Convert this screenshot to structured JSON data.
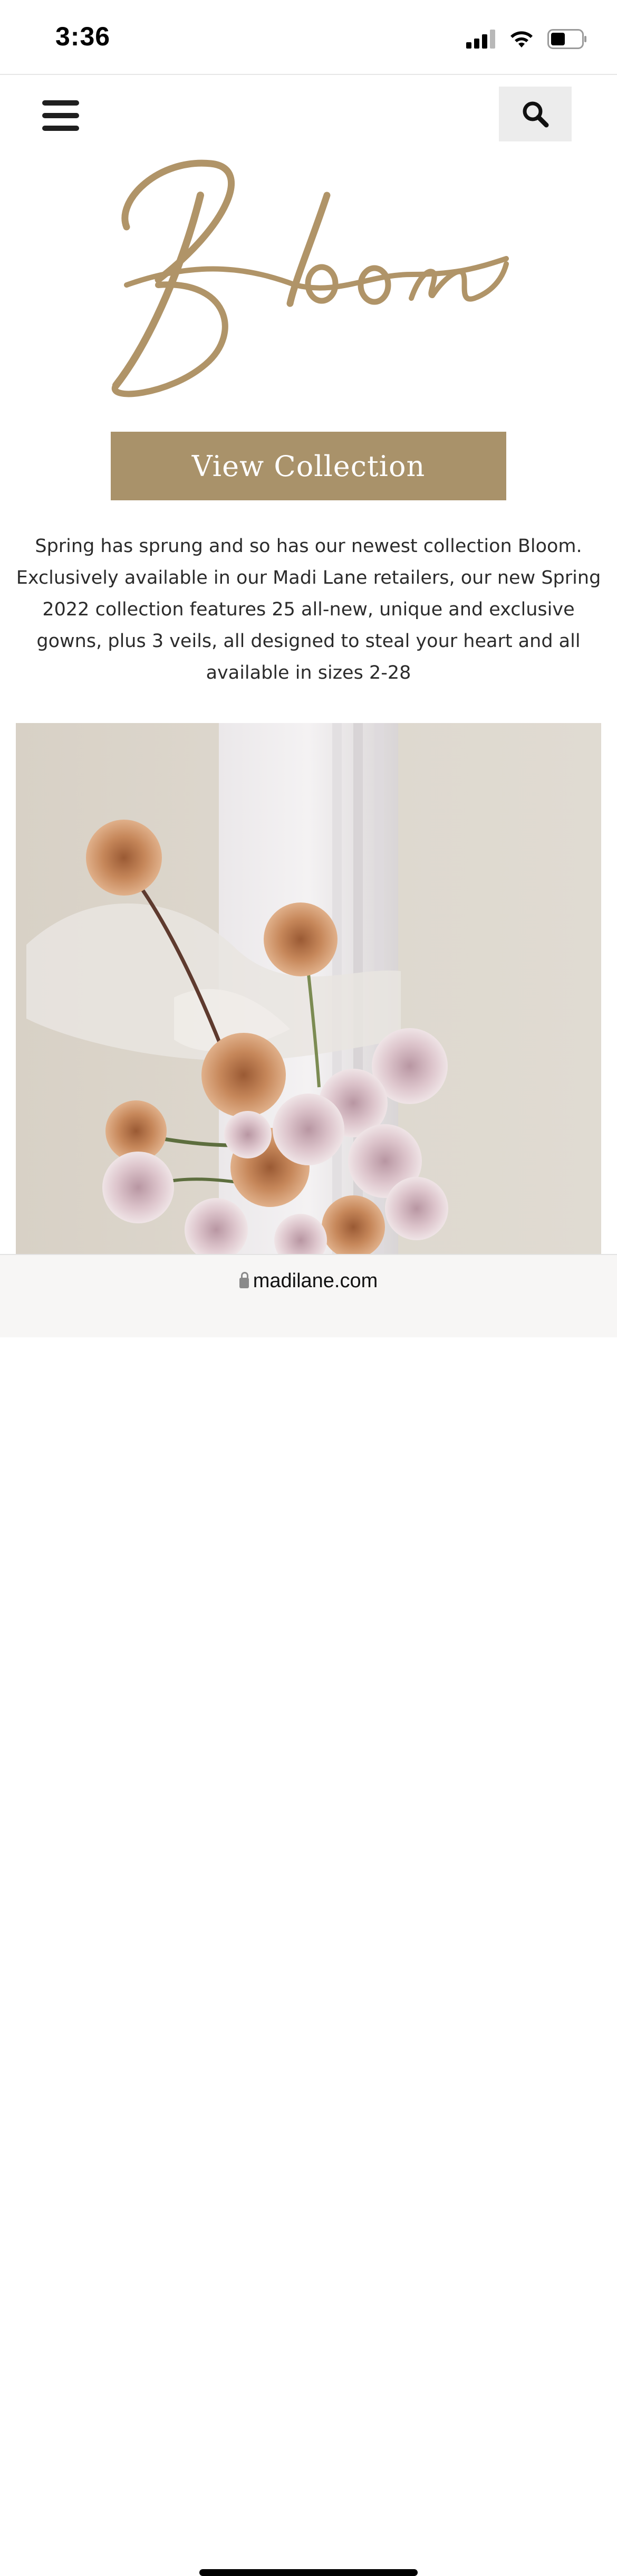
{
  "status_bar": {
    "time": "3:36",
    "icons": [
      "cellular-signal-icon",
      "wifi-icon",
      "battery-icon"
    ]
  },
  "header": {
    "menu_icon": "hamburger-menu-icon",
    "search_icon": "search-icon"
  },
  "logo": {
    "text": "Bloom",
    "color": "#b09468"
  },
  "cta": {
    "label": "View Collection",
    "color": "#a9926a"
  },
  "description": {
    "text": "Spring has sprung and so has our newest collection Bloom. Exclusively available in our Madi Lane retailers, our new Spring 2022 collection features 25 all-new, unique and exclusive gowns, plus 3 veils, all designed to steal your heart and all available in sizes 2-28"
  },
  "hero": {
    "subject": "roses-and-tulle-with-column"
  },
  "browser": {
    "url": "madilane.com",
    "lock_icon": "lock-icon"
  }
}
